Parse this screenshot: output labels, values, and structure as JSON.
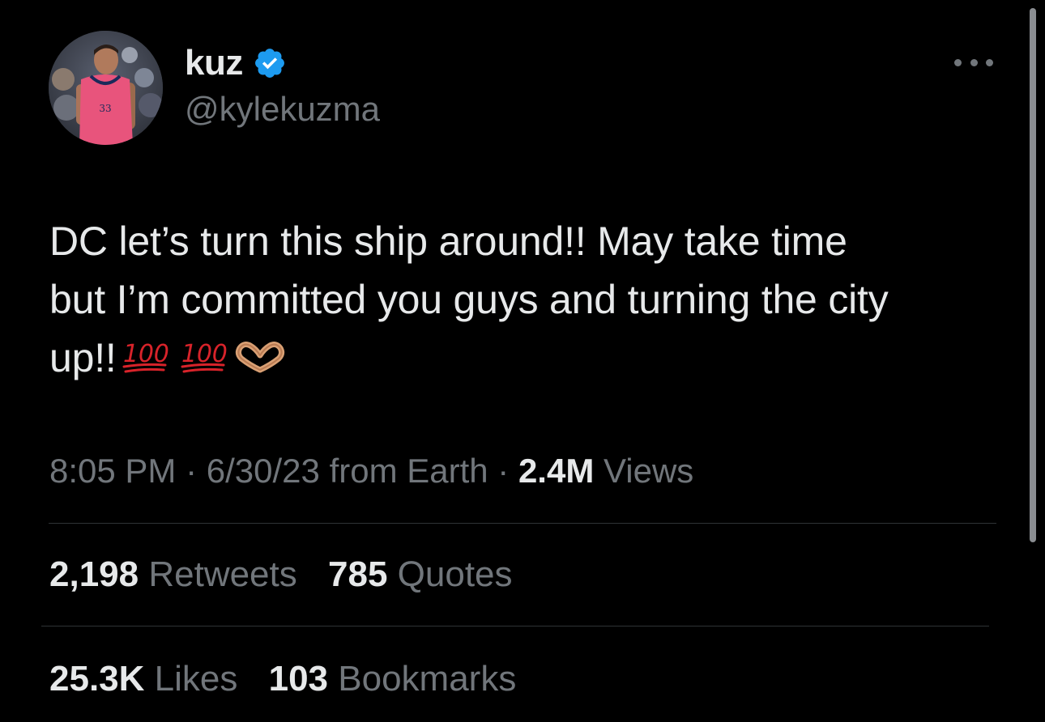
{
  "tweet": {
    "author": {
      "display_name": "kuz",
      "handle": "@kylekuzma",
      "verified": true,
      "verified_color": "#1d9bf0",
      "avatar_icon": "avatar-photo"
    },
    "text_line1": "DC let’s turn this ship around!! May take time",
    "text_line2": "but I’m committed you guys and turning the city",
    "text_line3": "up!!",
    "emojis": [
      "hundred-points-icon",
      "hundred-points-icon",
      "heart-hands-icon"
    ],
    "meta": {
      "time": "8:05 PM",
      "separator": " · ",
      "date": "6/30/23",
      "source": "from Earth",
      "views_count": "2.4M",
      "views_label": "Views"
    },
    "stats": {
      "retweets_count": "2,198",
      "retweets_label": "Retweets",
      "quotes_count": "785",
      "quotes_label": "Quotes",
      "likes_count": "25.3K",
      "likes_label": "Likes",
      "bookmarks_count": "103",
      "bookmarks_label": "Bookmarks"
    }
  },
  "colors": {
    "background": "#000000",
    "text_primary": "#e7e9ea",
    "text_secondary": "#71767b",
    "divider": "#2f3336",
    "emoji_red": "#d8232a"
  }
}
